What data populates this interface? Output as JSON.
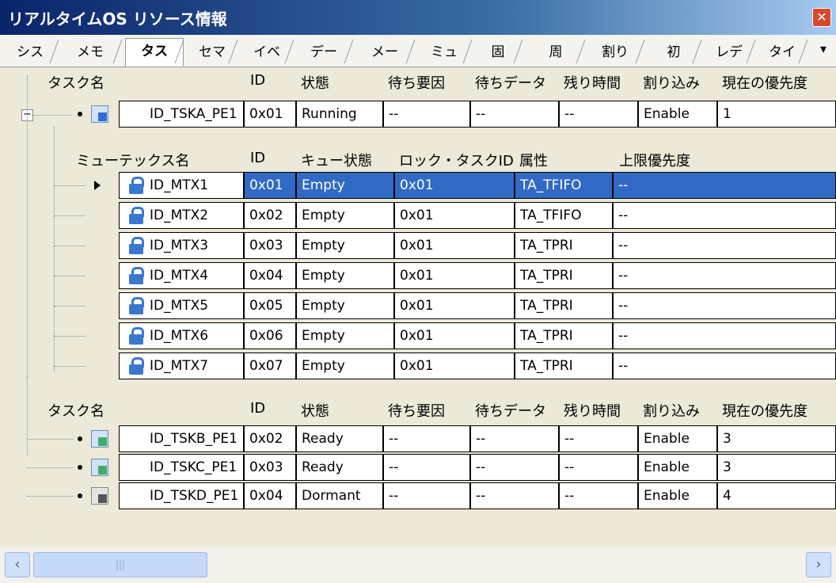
{
  "window": {
    "title": "リアルタイムOS リソース情報",
    "close_glyph": "✕"
  },
  "tabs": [
    "シス",
    "メモ",
    "タス",
    "セマ",
    "イベ",
    "デー",
    "メー",
    "ミュ",
    "固",
    "周",
    "割り",
    "初",
    "レデ",
    "タイ"
  ],
  "tabs_more_glyph": "▾",
  "task_headers": [
    "タスク名",
    "ID",
    "状態",
    "待ち要因",
    "待ちデータ",
    "残り時間",
    "割り込み",
    "現在の優先度"
  ],
  "task_running": {
    "name": "ID_TSKA_PE1",
    "id": "0x01",
    "state": "Running",
    "wait_factor": "--",
    "wait_data": "--",
    "remain": "--",
    "interrupt": "Enable",
    "priority": "1"
  },
  "mutex_headers": [
    "ミューテックス名",
    "ID",
    "キュー状態",
    "ロック・タスクID",
    "属性",
    "上限優先度"
  ],
  "mutexes": [
    {
      "name": "ID_MTX1",
      "id": "0x01",
      "queue": "Empty",
      "lock_task": "0x01",
      "attr": "TA_TFIFO",
      "ceil": "--"
    },
    {
      "name": "ID_MTX2",
      "id": "0x02",
      "queue": "Empty",
      "lock_task": "0x01",
      "attr": "TA_TFIFO",
      "ceil": "--"
    },
    {
      "name": "ID_MTX3",
      "id": "0x03",
      "queue": "Empty",
      "lock_task": "0x01",
      "attr": "TA_TPRI",
      "ceil": "--"
    },
    {
      "name": "ID_MTX4",
      "id": "0x04",
      "queue": "Empty",
      "lock_task": "0x01",
      "attr": "TA_TPRI",
      "ceil": "--"
    },
    {
      "name": "ID_MTX5",
      "id": "0x05",
      "queue": "Empty",
      "lock_task": "0x01",
      "attr": "TA_TPRI",
      "ceil": "--"
    },
    {
      "name": "ID_MTX6",
      "id": "0x06",
      "queue": "Empty",
      "lock_task": "0x01",
      "attr": "TA_TPRI",
      "ceil": "--"
    },
    {
      "name": "ID_MTX7",
      "id": "0x07",
      "queue": "Empty",
      "lock_task": "0x01",
      "attr": "TA_TPRI",
      "ceil": "--"
    }
  ],
  "other_tasks": [
    {
      "name": "ID_TSKB_PE1",
      "id": "0x02",
      "state": "Ready",
      "wait_factor": "--",
      "wait_data": "--",
      "remain": "--",
      "interrupt": "Enable",
      "priority": "3"
    },
    {
      "name": "ID_TSKC_PE1",
      "id": "0x03",
      "state": "Ready",
      "wait_factor": "--",
      "wait_data": "--",
      "remain": "--",
      "interrupt": "Enable",
      "priority": "3"
    },
    {
      "name": "ID_TSKD_PE1",
      "id": "0x04",
      "state": "Dormant",
      "wait_factor": "--",
      "wait_data": "--",
      "remain": "--",
      "interrupt": "Enable",
      "priority": "4"
    }
  ],
  "expander_glyph": "−",
  "scroll": {
    "left_glyph": "‹",
    "right_glyph": "›",
    "grip_glyph": "|||"
  },
  "colors": {
    "selection": "#316ac5",
    "titlebar": "#0a246a"
  }
}
